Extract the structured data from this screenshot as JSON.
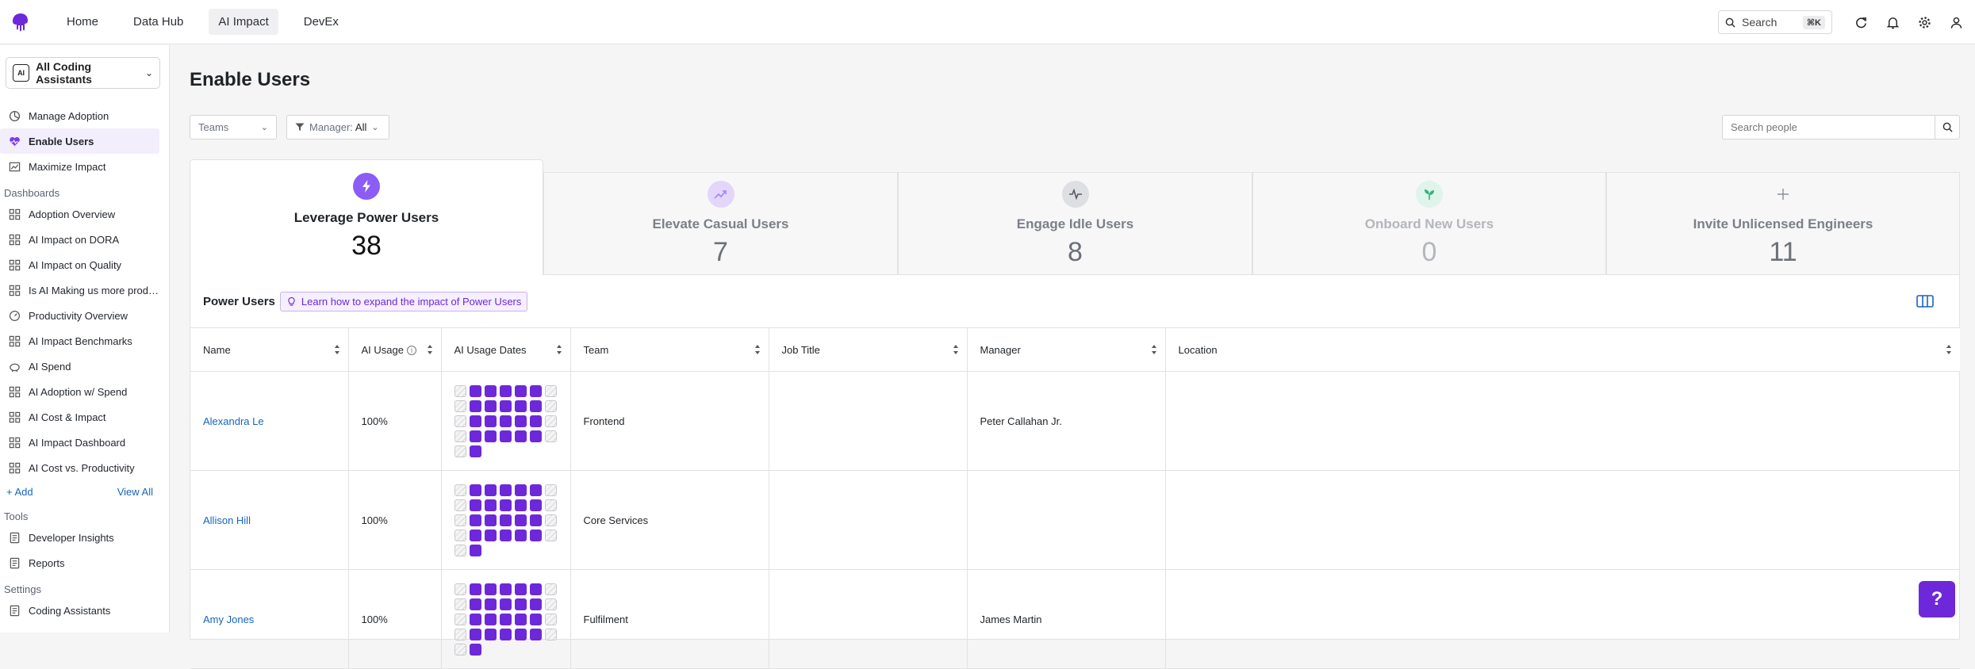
{
  "topnav": {
    "tabs": [
      {
        "label": "Home",
        "active": false
      },
      {
        "label": "Data Hub",
        "active": false
      },
      {
        "label": "AI Impact",
        "active": true
      },
      {
        "label": "DevEx",
        "active": false
      }
    ],
    "search_label": "Search",
    "search_shortcut": "⌘K",
    "icons": [
      "refresh-icon",
      "bell-icon",
      "gear-icon",
      "user-icon"
    ]
  },
  "sidebar": {
    "scope_chip": "AI",
    "scope_label": "All Coding Assistants",
    "primary": [
      {
        "label": "Manage Adoption",
        "icon": "pie-icon",
        "active": false
      },
      {
        "label": "Enable Users",
        "icon": "heart-icon",
        "active": true
      },
      {
        "label": "Maximize Impact",
        "icon": "chart-icon",
        "active": false
      }
    ],
    "dashboards_heading": "Dashboards",
    "dashboards": [
      {
        "label": "Adoption Overview",
        "icon": "grid-icon"
      },
      {
        "label": "AI Impact on DORA",
        "icon": "grid-icon"
      },
      {
        "label": "AI Impact on Quality",
        "icon": "grid-icon"
      },
      {
        "label": "Is AI Making us more productive?",
        "icon": "grid-icon"
      },
      {
        "label": "Productivity Overview",
        "icon": "gauge-icon"
      },
      {
        "label": "AI Impact Benchmarks",
        "icon": "grid-icon"
      },
      {
        "label": "AI Spend",
        "icon": "piggy-icon"
      },
      {
        "label": "AI Adoption w/ Spend",
        "icon": "grid-icon"
      },
      {
        "label": "AI Cost & Impact",
        "icon": "grid-icon"
      },
      {
        "label": "AI Impact Dashboard",
        "icon": "grid-icon"
      },
      {
        "label": "AI Cost vs. Productivity",
        "icon": "grid-icon"
      }
    ],
    "add_label": "+ Add",
    "view_all_label": "View All",
    "tools_heading": "Tools",
    "tools": [
      {
        "label": "Developer Insights",
        "icon": "doc-icon"
      },
      {
        "label": "Reports",
        "icon": "doc-icon"
      }
    ],
    "settings_heading": "Settings",
    "settings": [
      {
        "label": "Coding Assistants",
        "icon": "doc-icon"
      }
    ]
  },
  "page": {
    "title": "Enable Users",
    "teams_filter": "Teams",
    "manager_filter_label": "Manager:",
    "manager_filter_value": "All",
    "people_search_placeholder": "Search people"
  },
  "cards": [
    {
      "title": "Leverage Power Users",
      "value": "38",
      "icon": "lightning-icon",
      "color": "#7c3aed",
      "active": true
    },
    {
      "title": "Elevate Casual Users",
      "value": "7",
      "icon": "trend-up-icon",
      "color": "#a78bfa",
      "active": false
    },
    {
      "title": "Engage Idle Users",
      "value": "8",
      "icon": "pulse-icon",
      "color": "#6b7280",
      "active": false
    },
    {
      "title": "Onboard New Users",
      "value": "0",
      "icon": "sprout-icon",
      "color": "#10b981",
      "active": false
    },
    {
      "title": "Invite Unlicensed Engineers",
      "value": "11",
      "icon": "plus-icon",
      "color": "#6b7280",
      "active": false
    }
  ],
  "table": {
    "title": "Power Users",
    "learn_link": "Learn how to expand the impact of Power Users",
    "columns": [
      "Name",
      "AI Usage",
      "AI Usage Dates",
      "Team",
      "Job Title",
      "Manager",
      "Location"
    ],
    "rows": [
      {
        "name": "Alexandra Le",
        "usage": "100%",
        "team": "Frontend",
        "job_title": "",
        "manager": "Peter Callahan Jr.",
        "location": ""
      },
      {
        "name": "Allison Hill",
        "usage": "100%",
        "team": "Core Services",
        "job_title": "",
        "manager": "",
        "location": ""
      },
      {
        "name": "Amy Jones",
        "usage": "100%",
        "team": "Fulfilment",
        "job_title": "",
        "manager": "James Martin",
        "location": ""
      }
    ]
  },
  "help_label": "?"
}
